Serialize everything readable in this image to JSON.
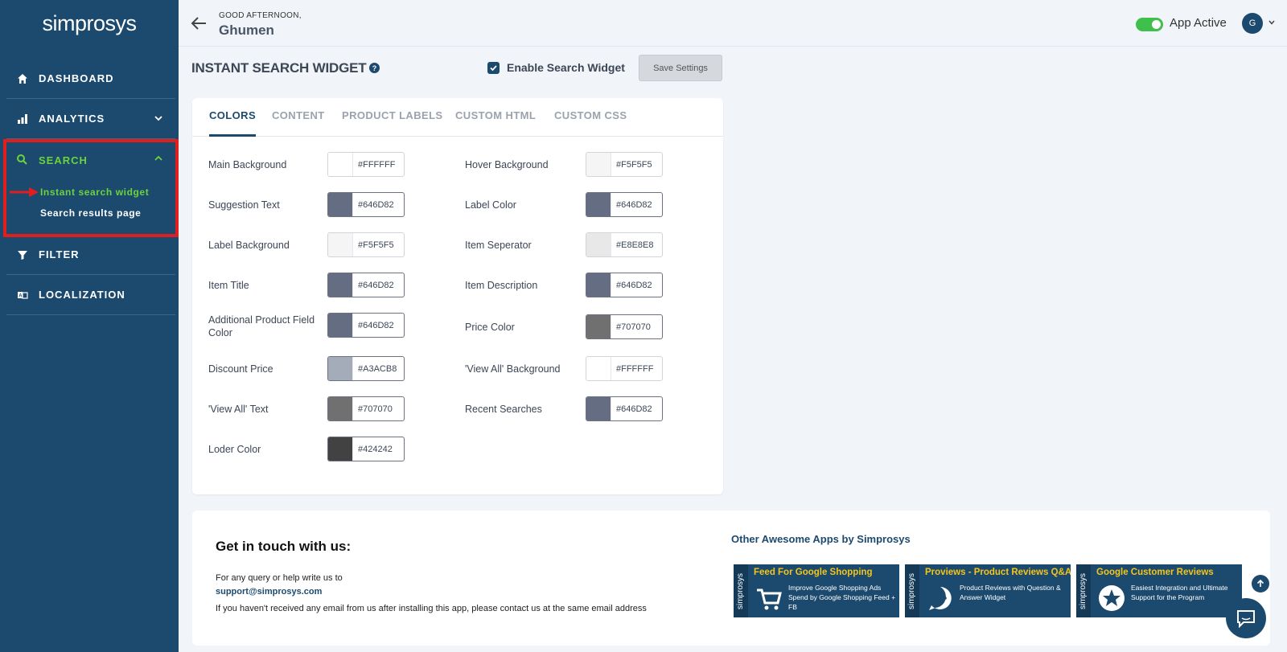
{
  "sidebar": {
    "logo": "simprosys",
    "items": [
      {
        "label": "DASHBOARD",
        "icon": "home-icon"
      },
      {
        "label": "ANALYTICS",
        "icon": "bar-chart-icon"
      },
      {
        "label": "SEARCH",
        "icon": "search-icon"
      },
      {
        "label": "FILTER",
        "icon": "filter-icon"
      },
      {
        "label": "LOCALIZATION",
        "icon": "translate-icon"
      }
    ],
    "search_sub": [
      "Instant search widget",
      "Search results page"
    ]
  },
  "topbar": {
    "greeting": "GOOD AFTERNOON,",
    "username": "Ghumen",
    "status_label": "App Active",
    "avatar_initial": "G"
  },
  "page": {
    "title": "INSTANT SEARCH WIDGET",
    "help": "?",
    "enable_label": "Enable Search Widget",
    "save_label": "Save Settings"
  },
  "tabs": [
    "COLORS",
    "CONTENT",
    "PRODUCT LABELS",
    "CUSTOM HTML",
    "CUSTOM CSS"
  ],
  "colors_left": [
    {
      "label": "Main Background",
      "hex": "#FFFFFF",
      "color": "#FFFFFF"
    },
    {
      "label": "Suggestion Text",
      "hex": "#646D82",
      "color": "#646D82"
    },
    {
      "label": "Label Background",
      "hex": "#F5F5F5",
      "color": "#F5F5F5"
    },
    {
      "label": "Item Title",
      "hex": "#646D82",
      "color": "#646D82"
    },
    {
      "label": "Additional Product Field Color",
      "hex": "#646D82",
      "color": "#646D82"
    },
    {
      "label": "Discount Price",
      "hex": "#A3ACB8",
      "color": "#A3ACB8"
    },
    {
      "label": "'View All' Text",
      "hex": "#707070",
      "color": "#707070"
    },
    {
      "label": "Loder Color",
      "hex": "#424242",
      "color": "#424242"
    }
  ],
  "colors_right": [
    {
      "label": "Hover Background",
      "hex": "#F5F5F5",
      "color": "#F5F5F5"
    },
    {
      "label": "Label Color",
      "hex": "#646D82",
      "color": "#646D82"
    },
    {
      "label": "Item Seperator",
      "hex": "#E8E8E8",
      "color": "#E8E8E8"
    },
    {
      "label": "Item Description",
      "hex": "#646D82",
      "color": "#646D82"
    },
    {
      "label": "Price Color",
      "hex": "#707070",
      "color": "#707070"
    },
    {
      "label": "'View All' Background",
      "hex": "#FFFFFF",
      "color": "#FFFFFF"
    },
    {
      "label": "Recent Searches",
      "hex": "#646D82",
      "color": "#646D82"
    }
  ],
  "footer": {
    "contact_title": "Get in touch with us:",
    "line1": "For any query or help write us to",
    "email": "support@simprosys.com",
    "line2": "If you haven't received any email from us after installing this app, please contact us at the same email address",
    "apps_title": "Other Awesome Apps by Simprosys",
    "apps": [
      {
        "name": "Feed For Google Shopping",
        "desc": "Improve Google Shopping Ads Spend by Google Shopping Feed + FB",
        "icon": "cart-icon",
        "side": "simprosys"
      },
      {
        "name": "Proviews - Product Reviews Q&A",
        "desc": "Product Reviews with Question & Answer Widget",
        "icon": "chat-bubble-icon",
        "side": "simprosys"
      },
      {
        "name": "Google Customer Reviews",
        "desc": "Easiest Integration and Ultimate Support for the Program",
        "icon": "star-badge-icon",
        "side": "simprosys"
      }
    ]
  }
}
